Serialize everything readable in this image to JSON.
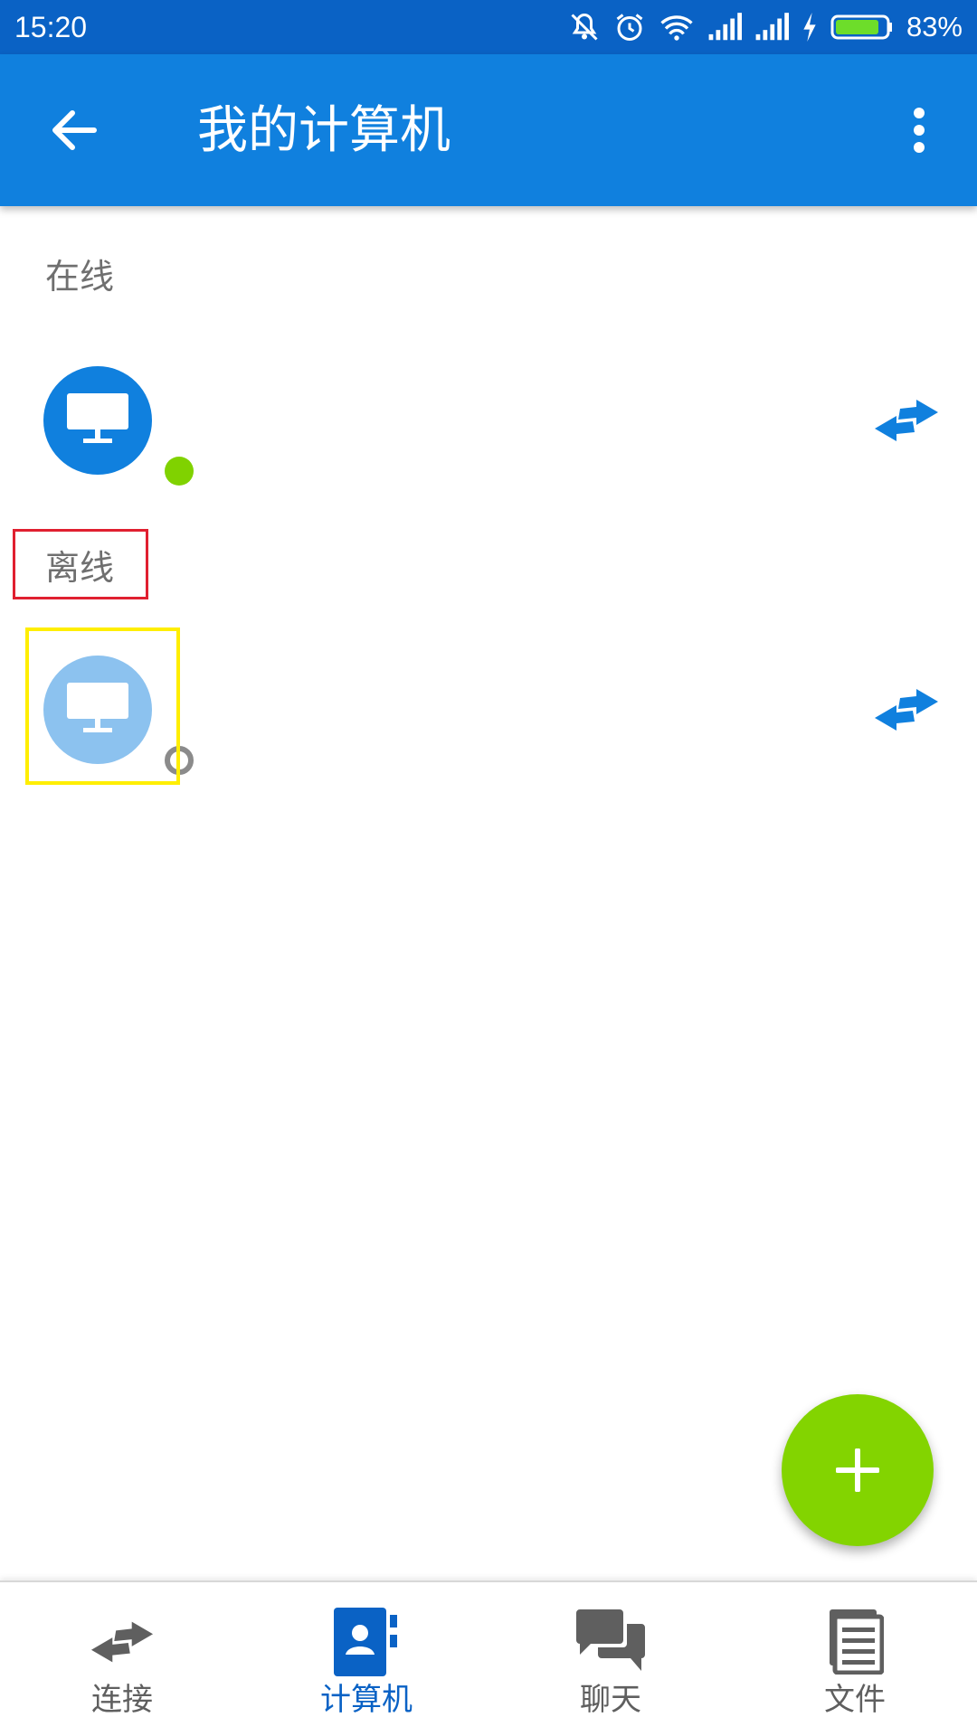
{
  "status_bar": {
    "time": "15:20",
    "battery_percent": "83%",
    "icons": [
      "mute-icon",
      "alarm-icon",
      "wifi-icon",
      "signal-icon",
      "signal-icon",
      "charging-icon",
      "battery-icon"
    ]
  },
  "app_bar": {
    "title": "我的计算机",
    "back_icon": "arrow-back-icon",
    "more_icon": "more-vert-icon"
  },
  "sections": {
    "online_label": "在线",
    "offline_label": "离线"
  },
  "computers": [
    {
      "status": "online",
      "icon": "monitor-icon",
      "action_icon": "connect-arrows-icon"
    },
    {
      "status": "offline",
      "icon": "monitor-icon",
      "action_icon": "connect-arrows-icon"
    }
  ],
  "fab": {
    "icon": "plus-icon"
  },
  "bottom_nav": [
    {
      "label": "连接",
      "icon": "connect-arrows-icon",
      "active": false
    },
    {
      "label": "计算机",
      "icon": "contacts-book-icon",
      "active": true
    },
    {
      "label": "聊天",
      "icon": "chat-bubbles-icon",
      "active": false
    },
    {
      "label": "文件",
      "icon": "files-icon",
      "active": false
    }
  ],
  "colors": {
    "status_bar": "#0a62c5",
    "app_bar": "#1080de",
    "online_dot": "#80d200",
    "offline_avatar": "#8cc2ef",
    "fab": "#83d400",
    "active_nav": "#0a62c5",
    "inactive_nav": "#5f5f5f"
  }
}
